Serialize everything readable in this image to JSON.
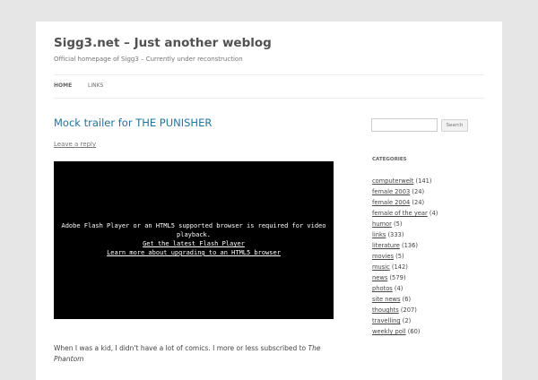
{
  "site": {
    "title": "Sigg3.net – Just another weblog",
    "description": "Official homepage of Sigg3 – Currently under reconstruction"
  },
  "nav": {
    "items": [
      {
        "label": "HOME"
      },
      {
        "label": "LINKS"
      }
    ]
  },
  "post": {
    "title": "Mock trailer for THE PUNISHER",
    "reply_label": "Leave a reply",
    "video": {
      "message_line1": "Adobe Flash Player or an HTML5 supported browser is required for video",
      "message_line2": "playback.",
      "link1": "Get the latest Flash Player",
      "link2": "Learn more about upgrading to an HTML5 browser"
    },
    "excerpt_start": "When I was a kid, I didn't have a lot of comics. I more or less subscribed to ",
    "excerpt_em": "The Phantom"
  },
  "sidebar": {
    "search_button": "Search",
    "categories_heading": "CATEGORIES",
    "categories": [
      {
        "name": "computerwelt",
        "count": "(141)"
      },
      {
        "name": "female 2003",
        "count": "(24)"
      },
      {
        "name": "female 2004",
        "count": "(24)"
      },
      {
        "name": "female of the year",
        "count": "(4)"
      },
      {
        "name": "humor",
        "count": "(5)"
      },
      {
        "name": "links",
        "count": "(333)"
      },
      {
        "name": "literature",
        "count": "(136)"
      },
      {
        "name": "movies",
        "count": "(5)"
      },
      {
        "name": "music",
        "count": "(142)"
      },
      {
        "name": "news",
        "count": "(579)"
      },
      {
        "name": "photos",
        "count": "(4)"
      },
      {
        "name": "site news",
        "count": "(6)"
      },
      {
        "name": "thoughts",
        "count": "(207)"
      },
      {
        "name": "travelling",
        "count": "(2)"
      },
      {
        "name": "weekly poll",
        "count": "(60)"
      }
    ]
  }
}
